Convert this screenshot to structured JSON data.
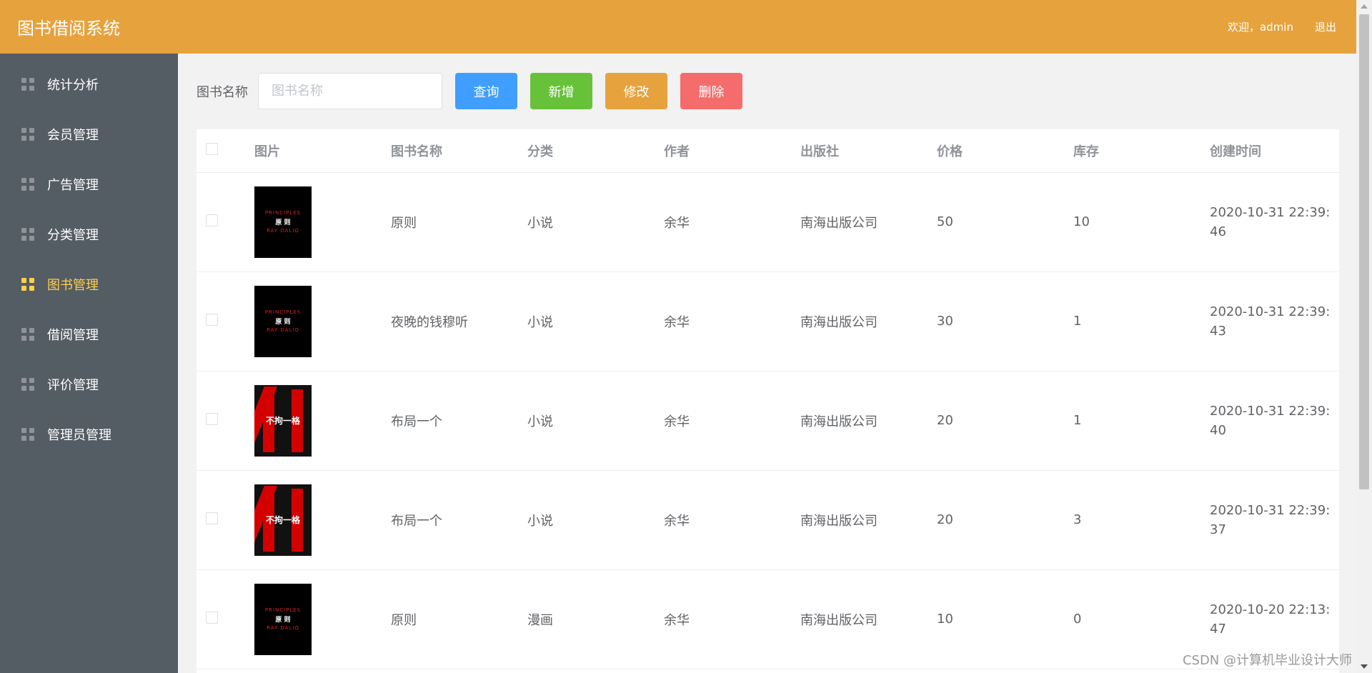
{
  "header": {
    "title": "图书借阅系统",
    "welcome": "欢迎，admin",
    "logout": "退出",
    "bg_color": "#e6a23c"
  },
  "sidebar": {
    "bg_color": "#545c64",
    "active_color": "#ffd04b",
    "items": [
      {
        "label": "统计分析",
        "icon": "grid-icon"
      },
      {
        "label": "会员管理",
        "icon": "grid-icon"
      },
      {
        "label": "广告管理",
        "icon": "grid-icon"
      },
      {
        "label": "分类管理",
        "icon": "grid-icon"
      },
      {
        "label": "图书管理",
        "icon": "grid-icon",
        "active": true
      },
      {
        "label": "借阅管理",
        "icon": "grid-icon"
      },
      {
        "label": "评价管理",
        "icon": "grid-icon"
      },
      {
        "label": "管理员管理",
        "icon": "grid-icon"
      }
    ]
  },
  "toolbar": {
    "search_label": "图书名称",
    "search_placeholder": "图书名称",
    "search_value": "",
    "query_label": "查询",
    "add_label": "新增",
    "edit_label": "修改",
    "delete_label": "删除"
  },
  "table": {
    "columns": [
      "图片",
      "图书名称",
      "分类",
      "作者",
      "出版社",
      "价格",
      "库存",
      "创建时间"
    ],
    "rows": [
      {
        "cover": {
          "type": "principles",
          "line1": "PRINCIPLES",
          "line2": "原 则",
          "line3": "RAY DALIO"
        },
        "name": "原则",
        "category": "小说",
        "author": "余华",
        "publisher": "南海出版公司",
        "price": "50",
        "stock": "10",
        "created": "2020-10-31 22:39:46"
      },
      {
        "cover": {
          "type": "principles",
          "line1": "PRINCIPLES",
          "line2": "原 则",
          "line3": "RAY DALIO"
        },
        "name": "夜晚的钱穆听",
        "category": "小说",
        "author": "余华",
        "publisher": "南海出版公司",
        "price": "30",
        "stock": "1",
        "created": "2020-10-31 22:39:43"
      },
      {
        "cover": {
          "type": "netflix",
          "text": "不拘一格"
        },
        "name": "布局一个",
        "category": "小说",
        "author": "余华",
        "publisher": "南海出版公司",
        "price": "20",
        "stock": "1",
        "created": "2020-10-31 22:39:40"
      },
      {
        "cover": {
          "type": "netflix",
          "text": "不拘一格"
        },
        "name": "布局一个",
        "category": "小说",
        "author": "余华",
        "publisher": "南海出版公司",
        "price": "20",
        "stock": "3",
        "created": "2020-10-31 22:39:37"
      },
      {
        "cover": {
          "type": "principles",
          "line1": "PRINCIPLES",
          "line2": "原 则",
          "line3": "RAY DALIO"
        },
        "name": "原则",
        "category": "漫画",
        "author": "余华",
        "publisher": "南海出版公司",
        "price": "10",
        "stock": "0",
        "created": "2020-10-20 22:13:47"
      }
    ]
  },
  "watermark": "CSDN @计算机毕业设计大师"
}
